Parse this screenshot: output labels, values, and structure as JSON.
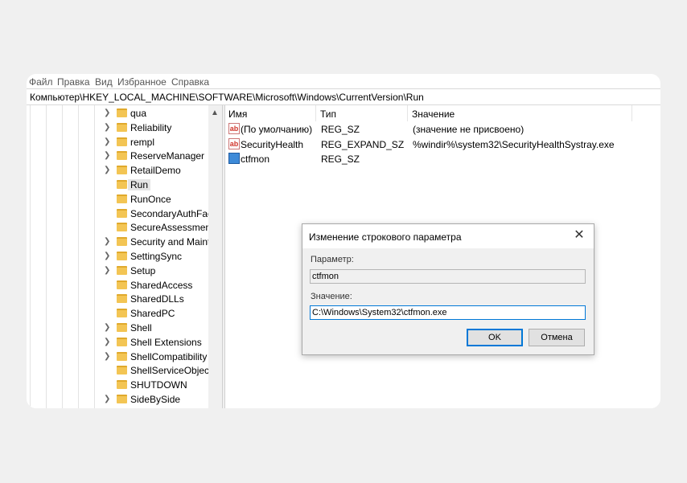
{
  "menu": [
    "Файл",
    "Правка",
    "Вид",
    "Избранное",
    "Справка"
  ],
  "address": "Компьютер\\HKEY_LOCAL_MACHINE\\SOFTWARE\\Microsoft\\Windows\\CurrentVersion\\Run",
  "tree": {
    "items": [
      {
        "label": "qua",
        "expandable": true
      },
      {
        "label": "Reliability",
        "expandable": true
      },
      {
        "label": "rempl",
        "expandable": true
      },
      {
        "label": "ReserveManager",
        "expandable": true
      },
      {
        "label": "RetailDemo",
        "expandable": true
      },
      {
        "label": "Run",
        "expandable": false,
        "selected": true
      },
      {
        "label": "RunOnce",
        "expandable": false
      },
      {
        "label": "SecondaryAuthFact",
        "expandable": false
      },
      {
        "label": "SecureAssessment",
        "expandable": false
      },
      {
        "label": "Security and Mainte",
        "expandable": true
      },
      {
        "label": "SettingSync",
        "expandable": true
      },
      {
        "label": "Setup",
        "expandable": true
      },
      {
        "label": "SharedAccess",
        "expandable": false
      },
      {
        "label": "SharedDLLs",
        "expandable": false
      },
      {
        "label": "SharedPC",
        "expandable": false
      },
      {
        "label": "Shell",
        "expandable": true
      },
      {
        "label": "Shell Extensions",
        "expandable": true
      },
      {
        "label": "ShellCompatibility",
        "expandable": true
      },
      {
        "label": "ShellServiceObjectD",
        "expandable": false
      },
      {
        "label": "SHUTDOWN",
        "expandable": false
      },
      {
        "label": "SideBySide",
        "expandable": true
      }
    ]
  },
  "list": {
    "columns": [
      "Имя",
      "Тип",
      "Значение"
    ],
    "rows": [
      {
        "icon": "string-value-icon",
        "name": "(По умолчанию)",
        "type": "REG_SZ",
        "value": "(значение не присвоено)"
      },
      {
        "icon": "string-value-icon",
        "name": "SecurityHealth",
        "type": "REG_EXPAND_SZ",
        "value": "%windir%\\system32\\SecurityHealthSystray.exe"
      },
      {
        "icon": "binary-value-icon",
        "name": "ctfmon",
        "type": "REG_SZ",
        "value": ""
      }
    ]
  },
  "dialog": {
    "title": "Изменение строкового параметра",
    "param_label": "Параметр:",
    "param_value": "ctfmon",
    "value_label": "Значение:",
    "value_value": "C:\\Windows\\System32\\ctfmon.exe",
    "ok": "OK",
    "cancel": "Отмена"
  },
  "colors": {
    "accent": "#0078d7",
    "folder": "#f3c554"
  }
}
